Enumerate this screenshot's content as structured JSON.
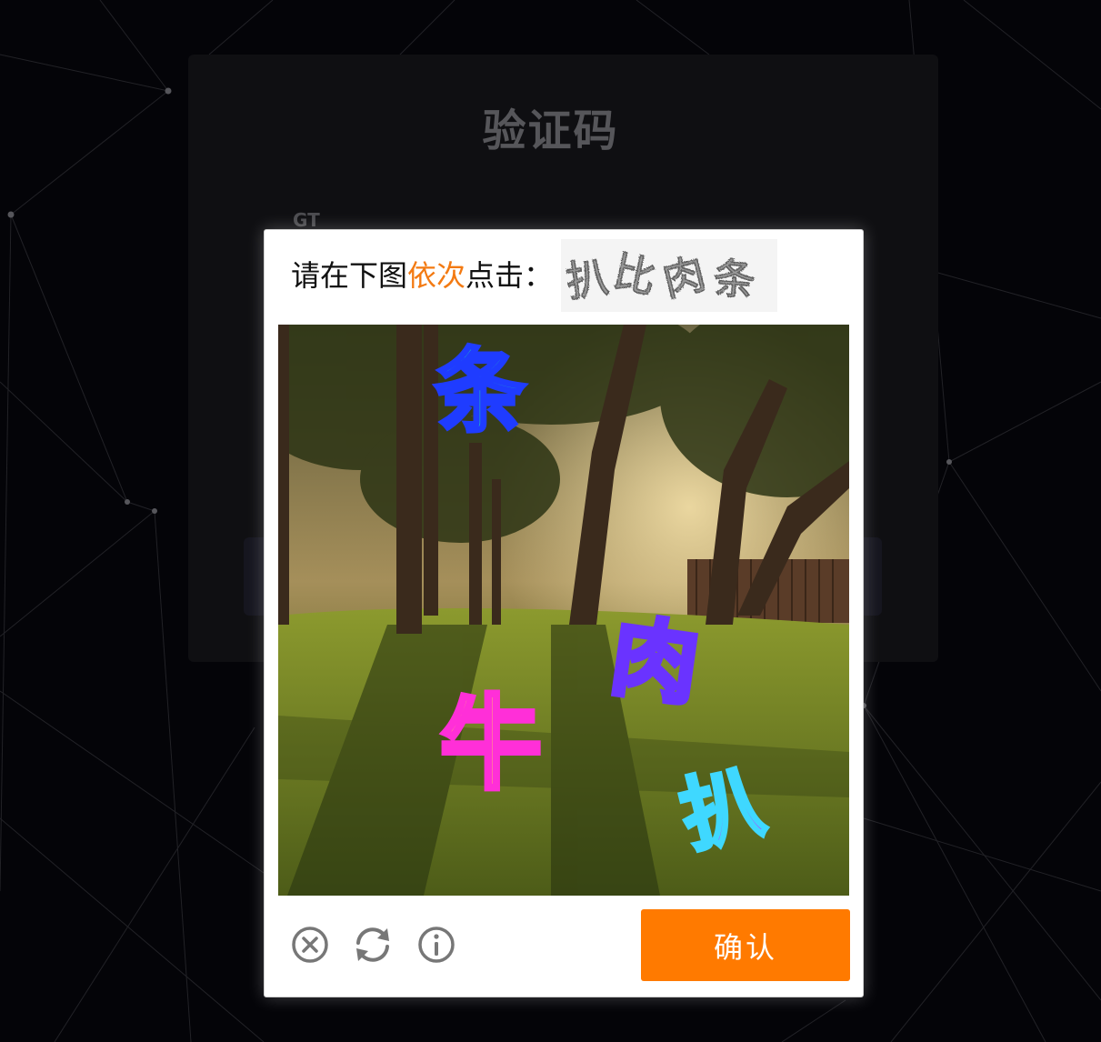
{
  "page": {
    "title": "验证码",
    "gt_label": "GT"
  },
  "captcha": {
    "prompt_prefix": "请在下图",
    "prompt_highlight": "依次",
    "prompt_suffix": "点击：",
    "target_characters": [
      "扒",
      "比",
      "肉",
      "条"
    ],
    "scene_characters": [
      "条",
      "肉",
      "牛",
      "扒"
    ],
    "confirm_label": "确认",
    "highlight_color": "#f37a12",
    "confirm_color": "#ff7a00"
  },
  "toolbar": {
    "close_icon": "close-circle-icon",
    "refresh_icon": "refresh-icon",
    "info_icon": "info-icon"
  }
}
